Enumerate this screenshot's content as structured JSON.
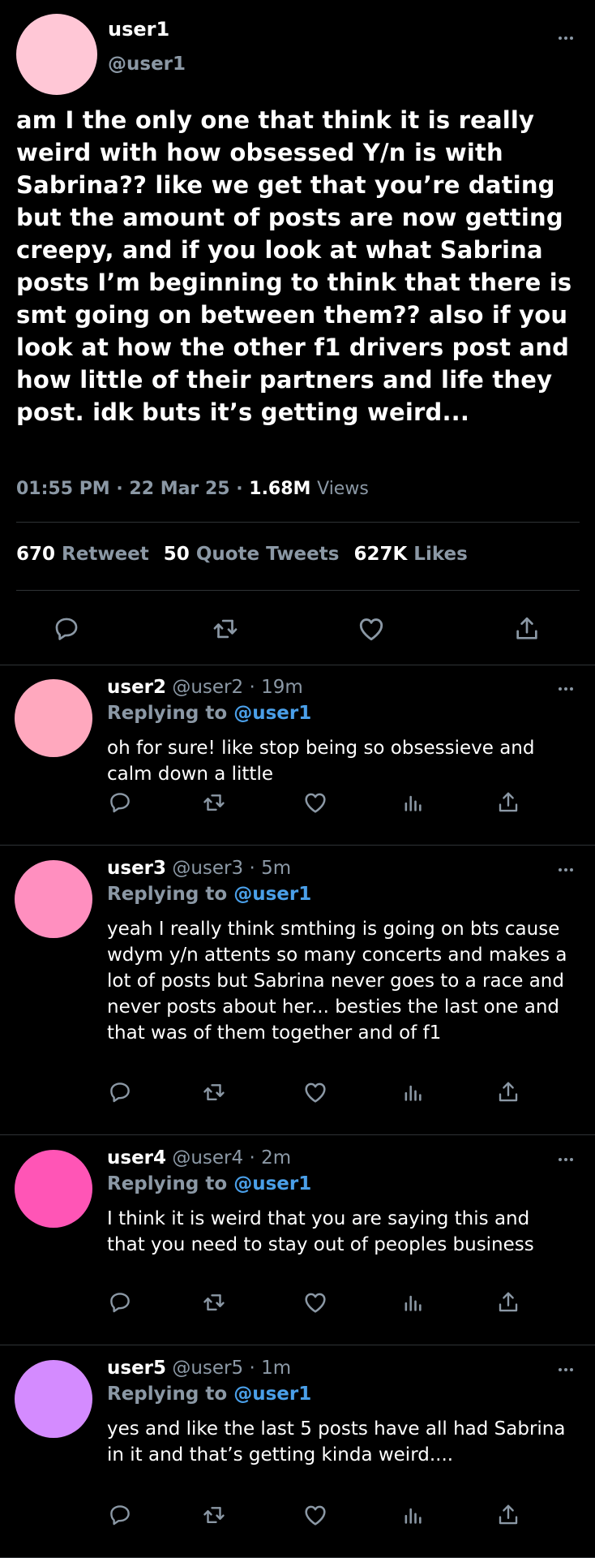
{
  "main_tweet": {
    "avatar_color": "#ffc7d6",
    "name": "user1",
    "handle": "@user1",
    "text": "am I the only one that think it is really weird with how obsessed Y/n is with Sabrina?? like we get that you’re dating but the amount of posts are now getting creepy, and if you look at what Sabrina posts I’m beginning to think that there is smt going on between them?? also if you look at how the other f1 drivers post and how little of their partners and life they post. idk buts it’s getting weird...",
    "time": "01:55 PM",
    "date": "22 Mar 25",
    "views_count": "1.68M",
    "views_label": "Views",
    "retweets_count": "670",
    "retweets_label": "Retweet",
    "quotes_count": "50",
    "quotes_label": "Quote Tweets",
    "likes_count": "627K",
    "likes_label": "Likes"
  },
  "replies": [
    {
      "avatar_color": "#ffa8be",
      "name": "user2",
      "handle": "@user2",
      "time": "19m",
      "replying_label": "Replying to",
      "replying_to": "@user1",
      "text": "oh for sure! like stop being so obsessieve and calm down a little"
    },
    {
      "avatar_color": "#ff8fbf",
      "name": "user3",
      "handle": "@user3",
      "time": "5m",
      "replying_label": "Replying to",
      "replying_to": "@user1",
      "text": "yeah I really think smthing is going on bts cause wdym y/n attents so many concerts and makes a lot of posts but Sabrina never goes to a race and never posts about her... besties the last one and that was of them together and of f1"
    },
    {
      "avatar_color": "#ff55b6",
      "name": "user4",
      "handle": "@user4",
      "time": "2m",
      "replying_label": "Replying to",
      "replying_to": "@user1",
      "text": "I think it is weird that you are saying this and that you need to stay out of peoples business"
    },
    {
      "avatar_color": "#d48bff",
      "name": "user5",
      "handle": "@user5",
      "time": "1m",
      "replying_label": "Replying to",
      "replying_to": "@user1",
      "text": "yes and like the last 5 posts have all had Sabrina in it and that’s getting kinda weird...."
    }
  ],
  "colors": {
    "background": "#000000",
    "secondary_text": "#8b98a5",
    "link": "#4a9fe8",
    "divider": "#2f3336"
  },
  "icons": [
    "reply-icon",
    "retweet-icon",
    "like-icon",
    "share-icon",
    "views-icon",
    "more-icon"
  ]
}
